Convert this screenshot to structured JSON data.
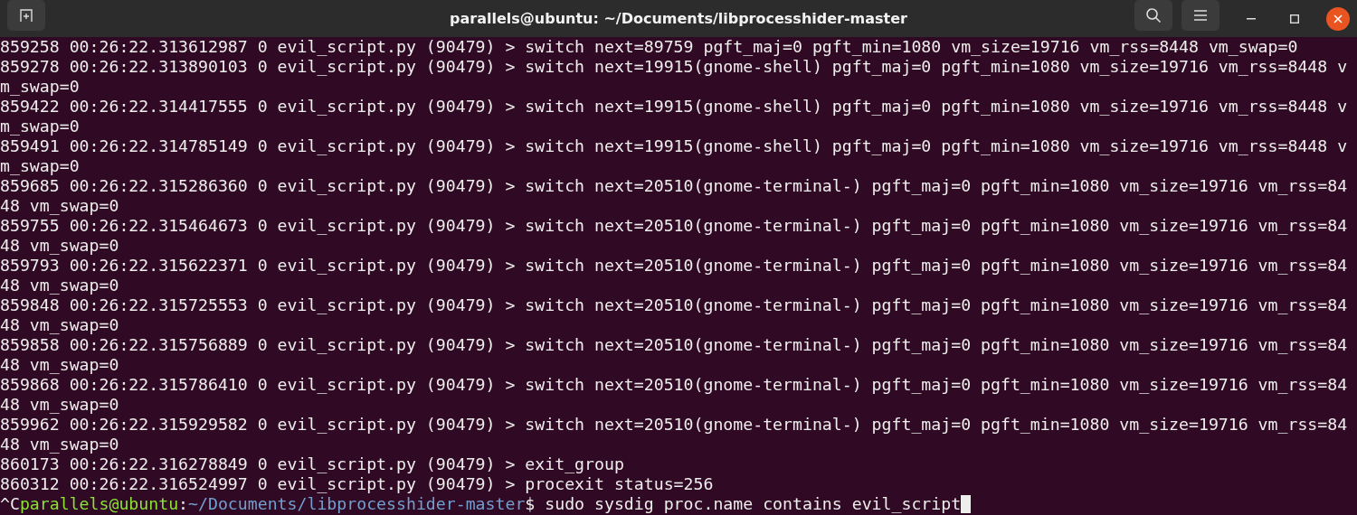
{
  "window": {
    "title": "parallels@ubuntu: ~/Documents/libprocesshider-master"
  },
  "lines": [
    "859258 00:26:22.313612987 0 evil_script.py (90479) > switch next=89759 pgft_maj=0 pgft_min=1080 vm_size=19716 vm_rss=8448 vm_swap=0",
    "859278 00:26:22.313890103 0 evil_script.py (90479) > switch next=19915(gnome-shell) pgft_maj=0 pgft_min=1080 vm_size=19716 vm_rss=8448 v",
    "m_swap=0",
    "859422 00:26:22.314417555 0 evil_script.py (90479) > switch next=19915(gnome-shell) pgft_maj=0 pgft_min=1080 vm_size=19716 vm_rss=8448 v",
    "m_swap=0",
    "859491 00:26:22.314785149 0 evil_script.py (90479) > switch next=19915(gnome-shell) pgft_maj=0 pgft_min=1080 vm_size=19716 vm_rss=8448 v",
    "m_swap=0",
    "859685 00:26:22.315286360 0 evil_script.py (90479) > switch next=20510(gnome-terminal-) pgft_maj=0 pgft_min=1080 vm_size=19716 vm_rss=84",
    "48 vm_swap=0",
    "859755 00:26:22.315464673 0 evil_script.py (90479) > switch next=20510(gnome-terminal-) pgft_maj=0 pgft_min=1080 vm_size=19716 vm_rss=84",
    "48 vm_swap=0",
    "859793 00:26:22.315622371 0 evil_script.py (90479) > switch next=20510(gnome-terminal-) pgft_maj=0 pgft_min=1080 vm_size=19716 vm_rss=84",
    "48 vm_swap=0",
    "859848 00:26:22.315725553 0 evil_script.py (90479) > switch next=20510(gnome-terminal-) pgft_maj=0 pgft_min=1080 vm_size=19716 vm_rss=84",
    "48 vm_swap=0",
    "859858 00:26:22.315756889 0 evil_script.py (90479) > switch next=20510(gnome-terminal-) pgft_maj=0 pgft_min=1080 vm_size=19716 vm_rss=84",
    "48 vm_swap=0",
    "859868 00:26:22.315786410 0 evil_script.py (90479) > switch next=20510(gnome-terminal-) pgft_maj=0 pgft_min=1080 vm_size=19716 vm_rss=84",
    "48 vm_swap=0",
    "859962 00:26:22.315929582 0 evil_script.py (90479) > switch next=20510(gnome-terminal-) pgft_maj=0 pgft_min=1080 vm_size=19716 vm_rss=84",
    "48 vm_swap=0",
    "860173 00:26:22.316278849 0 evil_script.py (90479) > exit_group",
    "860312 00:26:22.316524997 0 evil_script.py (90479) > procexit status=256"
  ],
  "prompt": {
    "interrupt": "^C",
    "user_host": "parallels@ubuntu",
    "separator": ":",
    "path": "~/Documents/libprocesshider-master",
    "command": "$ sudo sysdig proc.name contains evil_script"
  }
}
